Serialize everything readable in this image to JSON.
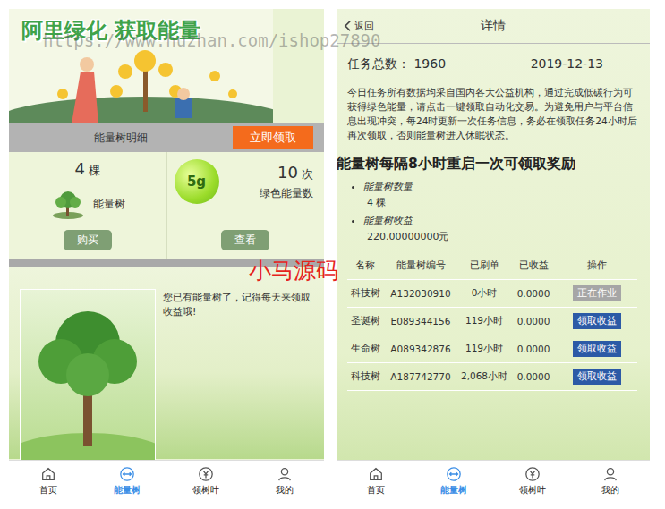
{
  "watermarks": {
    "url": "https://www.huzhan.com/ishop27890",
    "brand": "小马源码"
  },
  "tabs": [
    {
      "label": "首页",
      "selected": false
    },
    {
      "label": "能量树",
      "selected": true
    },
    {
      "label": "领树叶",
      "selected": false
    },
    {
      "label": "我的",
      "selected": false
    }
  ],
  "left": {
    "banner": {
      "title": "阿里绿化 获取能量"
    },
    "detail_bar": {
      "label": "能量树明细",
      "button": "立即领取"
    },
    "stats": [
      {
        "kind": "tree",
        "value": "4",
        "unit": "棵",
        "label": "能量树",
        "button": "购买"
      },
      {
        "kind": "energy",
        "value": "10",
        "unit": "次",
        "label": "绿色能量数",
        "button": "查看",
        "badge": "5g"
      }
    ],
    "notice": "您已有能量树了，记得每天来领取收益哦!"
  },
  "right": {
    "back": "返回",
    "title": "详情",
    "task_label": "任务总数：",
    "task_total": "1960",
    "date": "2019-12-13",
    "intro": "今日任务所有数据均采自国内各大公益机构，通过完成低碳行为可获得绿色能量，请点击一键领取自动化交易。为避免用户与平台信息出现冲突，每24时更新一次任务信息，务必在领取任务24小时后再次领取，否则能量树进入休眠状态。",
    "headline": "能量树每隔8小时重启一次可领取奖励",
    "summary": [
      {
        "label": "能量树数量",
        "value": "4 棵"
      },
      {
        "label": "能量树收益",
        "value": "220.00000000元"
      }
    ],
    "table": {
      "columns": [
        "名称",
        "能量树编号",
        "已刷单",
        "已收益",
        "操作"
      ],
      "rows": [
        {
          "name": "科技树",
          "code": "A132030910",
          "hours": "0小时",
          "earned": "0.0000",
          "action": "正在作业",
          "kind": "working"
        },
        {
          "name": "圣诞树",
          "code": "E089344156",
          "hours": "119小时",
          "earned": "0.0000",
          "action": "领取收益",
          "kind": "claim"
        },
        {
          "name": "生命树",
          "code": "A089342876",
          "hours": "119小时",
          "earned": "0.0000",
          "action": "领取收益",
          "kind": "claim"
        },
        {
          "name": "科技树",
          "code": "A187742770",
          "hours": "2,068小时",
          "earned": "0.0000",
          "action": "领取收益",
          "kind": "claim"
        }
      ]
    }
  }
}
